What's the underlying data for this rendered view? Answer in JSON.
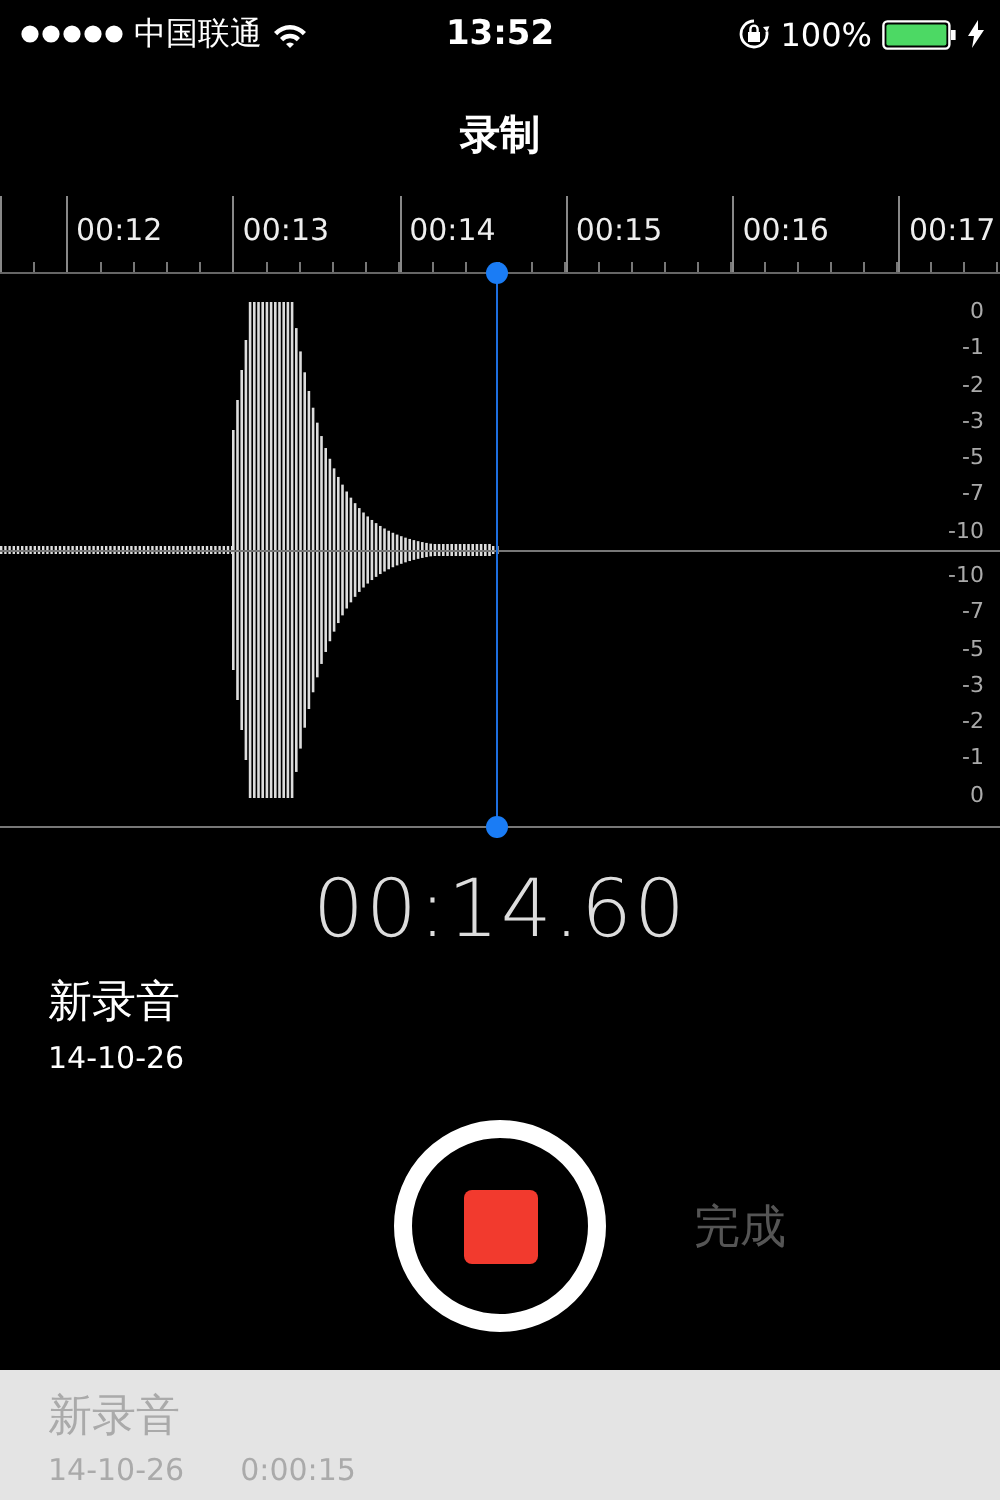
{
  "status_bar": {
    "carrier": "中国联通",
    "time": "13:52",
    "battery": "100%"
  },
  "title": "录制",
  "timeline": {
    "labels": [
      "00:12",
      "00:13",
      "00:14",
      "00:15",
      "00:16",
      "00:17"
    ]
  },
  "scale": {
    "upper": [
      "0",
      "-1",
      "-2",
      "-3",
      "-5",
      "-7",
      "-10"
    ],
    "lower": [
      "-10",
      "-7",
      "-5",
      "-3",
      "-2",
      "-1",
      "0"
    ]
  },
  "elapsed": "00:14.60",
  "current": {
    "name": "新录音",
    "date": "14-10-26"
  },
  "record_button": {
    "recording": true
  },
  "done_button": {
    "label": "完成",
    "disabled": true
  },
  "memos": [
    {
      "name": "新录音",
      "date": "14-10-26",
      "duration": "0:00:15"
    }
  ]
}
